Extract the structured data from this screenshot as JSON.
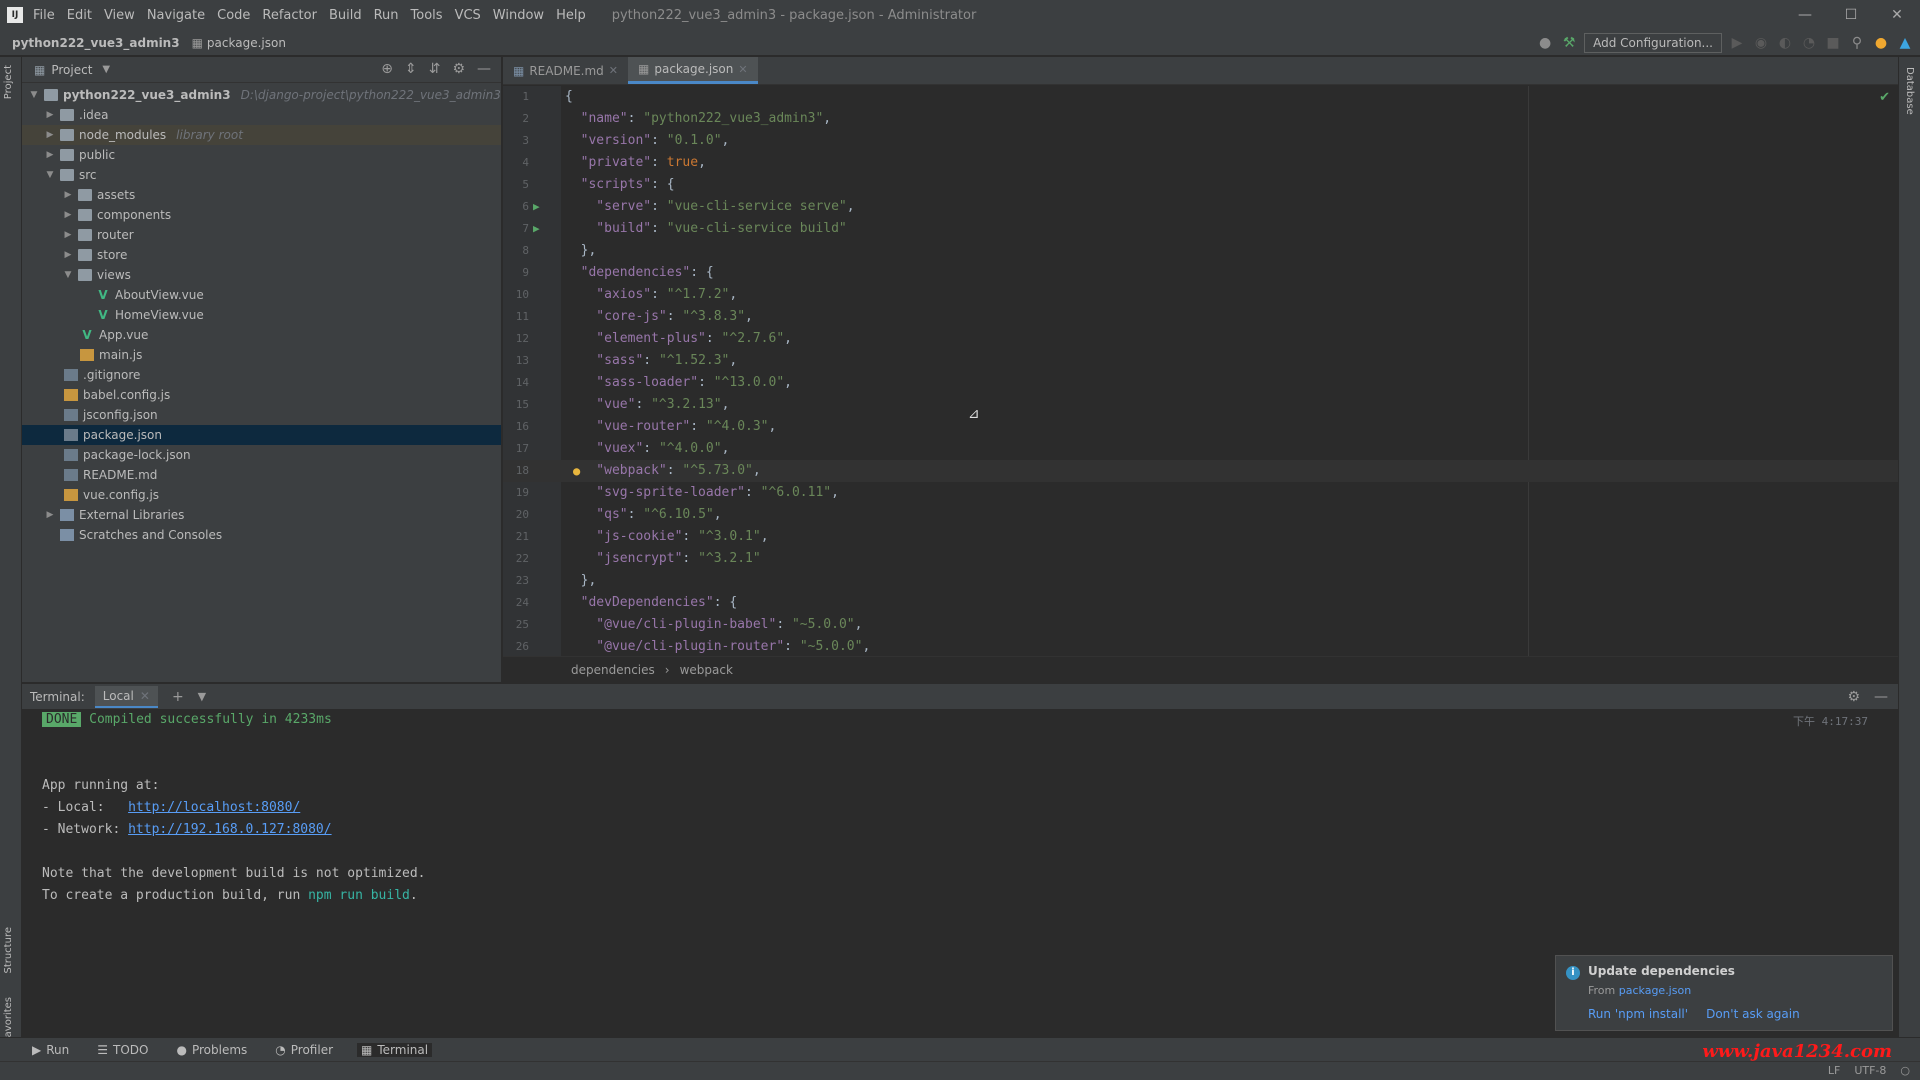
{
  "menubar": {
    "logo": "IJ",
    "items": [
      "File",
      "Edit",
      "View",
      "Navigate",
      "Code",
      "Refactor",
      "Build",
      "Run",
      "Tools",
      "VCS",
      "Window",
      "Help"
    ],
    "window_title": "python222_vue3_admin3 - package.json - Administrator"
  },
  "navbar": {
    "project": "python222_vue3_admin3",
    "file": "package.json",
    "add_configuration": "Add Configuration..."
  },
  "left_strip": {
    "project_tab": "Project",
    "structure_tab": "Structure",
    "favorites_tab": "Favorites"
  },
  "right_strip": {
    "database_tab": "Database"
  },
  "project_panel": {
    "title": "Project",
    "tree": [
      {
        "label": "python222_vue3_admin3",
        "hint": "D:\\django-project\\python222_vue3_admin3",
        "kind": "folder",
        "bold": true
      },
      {
        "label": ".idea",
        "kind": "folder"
      },
      {
        "label": "node_modules",
        "hint": "library root",
        "kind": "folder"
      },
      {
        "label": "public",
        "kind": "folder"
      },
      {
        "label": "src",
        "kind": "folder"
      },
      {
        "label": "assets",
        "kind": "folder"
      },
      {
        "label": "components",
        "kind": "folder"
      },
      {
        "label": "router",
        "kind": "folder"
      },
      {
        "label": "store",
        "kind": "folder"
      },
      {
        "label": "views",
        "kind": "folder"
      },
      {
        "label": "AboutView.vue",
        "kind": "vue"
      },
      {
        "label": "HomeView.vue",
        "kind": "vue"
      },
      {
        "label": "App.vue",
        "kind": "vue"
      },
      {
        "label": "main.js",
        "kind": "js"
      },
      {
        "label": ".gitignore",
        "kind": "file"
      },
      {
        "label": "babel.config.js",
        "kind": "js"
      },
      {
        "label": "jsconfig.json",
        "kind": "file"
      },
      {
        "label": "package.json",
        "kind": "file"
      },
      {
        "label": "package-lock.json",
        "kind": "file"
      },
      {
        "label": "README.md",
        "kind": "file"
      },
      {
        "label": "vue.config.js",
        "kind": "js"
      },
      {
        "label": "External Libraries",
        "kind": "lib"
      },
      {
        "label": "Scratches and Consoles",
        "kind": "lib"
      }
    ]
  },
  "editor": {
    "tabs": [
      {
        "label": "README.md"
      },
      {
        "label": "package.json"
      }
    ],
    "lines": [
      {
        "n": "1",
        "parts": [
          [
            "p",
            "{"
          ]
        ]
      },
      {
        "n": "2",
        "parts": [
          [
            "k",
            "  \"name\""
          ],
          [
            "p",
            ": "
          ],
          [
            "s",
            "\"python222_vue3_admin3\""
          ],
          [
            "p",
            ","
          ]
        ]
      },
      {
        "n": "3",
        "parts": [
          [
            "k",
            "  \"version\""
          ],
          [
            "p",
            ": "
          ],
          [
            "s",
            "\"0.1.0\""
          ],
          [
            "p",
            ","
          ]
        ]
      },
      {
        "n": "4",
        "parts": [
          [
            "k",
            "  \"private\""
          ],
          [
            "p",
            ": "
          ],
          [
            "b",
            "true"
          ],
          [
            "p",
            ","
          ]
        ]
      },
      {
        "n": "5",
        "parts": [
          [
            "k",
            "  \"scripts\""
          ],
          [
            "p",
            ": {"
          ]
        ]
      },
      {
        "n": "6",
        "parts": [
          [
            "k",
            "    \"serve\""
          ],
          [
            "p",
            ": "
          ],
          [
            "s",
            "\"vue-cli-service serve\""
          ],
          [
            "p",
            ","
          ]
        ]
      },
      {
        "n": "7",
        "parts": [
          [
            "k",
            "    \"build\""
          ],
          [
            "p",
            ": "
          ],
          [
            "s",
            "\"vue-cli-service build\""
          ]
        ]
      },
      {
        "n": "8",
        "parts": [
          [
            "p",
            "  },"
          ]
        ]
      },
      {
        "n": "9",
        "parts": [
          [
            "k",
            "  \"dependencies\""
          ],
          [
            "p",
            ": {"
          ]
        ]
      },
      {
        "n": "10",
        "parts": [
          [
            "k",
            "    \"axios\""
          ],
          [
            "p",
            ": "
          ],
          [
            "s",
            "\"^1.7.2\""
          ],
          [
            "p",
            ","
          ]
        ]
      },
      {
        "n": "11",
        "parts": [
          [
            "k",
            "    \"core-js\""
          ],
          [
            "p",
            ": "
          ],
          [
            "s",
            "\"^3.8.3\""
          ],
          [
            "p",
            ","
          ]
        ]
      },
      {
        "n": "12",
        "parts": [
          [
            "k",
            "    \"element-plus\""
          ],
          [
            "p",
            ": "
          ],
          [
            "s",
            "\"^2.7.6\""
          ],
          [
            "p",
            ","
          ]
        ]
      },
      {
        "n": "13",
        "parts": [
          [
            "k",
            "    \"sass\""
          ],
          [
            "p",
            ": "
          ],
          [
            "s",
            "\"^1.52.3\""
          ],
          [
            "p",
            ","
          ]
        ]
      },
      {
        "n": "14",
        "parts": [
          [
            "k",
            "    \"sass-loader\""
          ],
          [
            "p",
            ": "
          ],
          [
            "s",
            "\"^13.0.0\""
          ],
          [
            "p",
            ","
          ]
        ]
      },
      {
        "n": "15",
        "parts": [
          [
            "k",
            "    \"vue\""
          ],
          [
            "p",
            ": "
          ],
          [
            "s",
            "\"^3.2.13\""
          ],
          [
            "p",
            ","
          ]
        ]
      },
      {
        "n": "16",
        "parts": [
          [
            "k",
            "    \"vue-router\""
          ],
          [
            "p",
            ": "
          ],
          [
            "s",
            "\"^4.0.3\""
          ],
          [
            "p",
            ","
          ]
        ]
      },
      {
        "n": "17",
        "parts": [
          [
            "k",
            "    \"vuex\""
          ],
          [
            "p",
            ": "
          ],
          [
            "s",
            "\"^4.0.0\""
          ],
          [
            "p",
            ","
          ]
        ]
      },
      {
        "n": "18",
        "parts": [
          [
            "k",
            "    \"webpack\""
          ],
          [
            "p",
            ": "
          ],
          [
            "s",
            "\"^5.73.0\""
          ],
          [
            "p",
            ","
          ]
        ]
      },
      {
        "n": "19",
        "parts": [
          [
            "k",
            "    \"svg-sprite-loader\""
          ],
          [
            "p",
            ": "
          ],
          [
            "s",
            "\"^6.0.11\""
          ],
          [
            "p",
            ","
          ]
        ]
      },
      {
        "n": "20",
        "parts": [
          [
            "k",
            "    \"qs\""
          ],
          [
            "p",
            ": "
          ],
          [
            "s",
            "\"^6.10.5\""
          ],
          [
            "p",
            ","
          ]
        ]
      },
      {
        "n": "21",
        "parts": [
          [
            "k",
            "    \"js-cookie\""
          ],
          [
            "p",
            ": "
          ],
          [
            "s",
            "\"^3.0.1\""
          ],
          [
            "p",
            ","
          ]
        ]
      },
      {
        "n": "22",
        "parts": [
          [
            "k",
            "    \"jsencrypt\""
          ],
          [
            "p",
            ": "
          ],
          [
            "s",
            "\"^3.2.1\""
          ]
        ]
      },
      {
        "n": "23",
        "parts": [
          [
            "p",
            "  },"
          ]
        ]
      },
      {
        "n": "24",
        "parts": [
          [
            "k",
            "  \"devDependencies\""
          ],
          [
            "p",
            ": {"
          ]
        ]
      },
      {
        "n": "25",
        "parts": [
          [
            "k",
            "    \"@vue/cli-plugin-babel\""
          ],
          [
            "p",
            ": "
          ],
          [
            "s",
            "\"~5.0.0\""
          ],
          [
            "p",
            ","
          ]
        ]
      },
      {
        "n": "26",
        "parts": [
          [
            "k",
            "    \"@vue/cli-plugin-router\""
          ],
          [
            "p",
            ": "
          ],
          [
            "s",
            "\"~5.0.0\""
          ],
          [
            "p",
            ","
          ]
        ]
      }
    ],
    "breadcrumb": [
      "dependencies",
      "webpack"
    ]
  },
  "terminal": {
    "title": "Terminal:",
    "tab": "Local",
    "time": "下午 4:17:37",
    "done": "DONE",
    "compiled": "Compiled successfully in 4233ms",
    "app_running": "App running at:",
    "local_label": "- Local:   ",
    "local_url": "http://localhost:8080/",
    "network_label": "- Network: ",
    "network_url": "http://192.168.0.127:8080/",
    "note": "Note that the development build is not optimized.",
    "prod_prefix": "To create a production build, run ",
    "prod_cmd": "npm run build",
    "prod_suffix": "."
  },
  "notification": {
    "title": "Update dependencies",
    "from_prefix": "From ",
    "from_link": "package.json",
    "action_install": "Run 'npm install'",
    "action_dismiss": "Don't ask again"
  },
  "bottom_tools": [
    "Run",
    "TODO",
    "Problems",
    "Profiler",
    "Terminal"
  ],
  "status": {
    "line_sep": "LF",
    "encoding": "UTF-8",
    "event_log": "Event Log"
  },
  "watermark": "www.java1234.com"
}
